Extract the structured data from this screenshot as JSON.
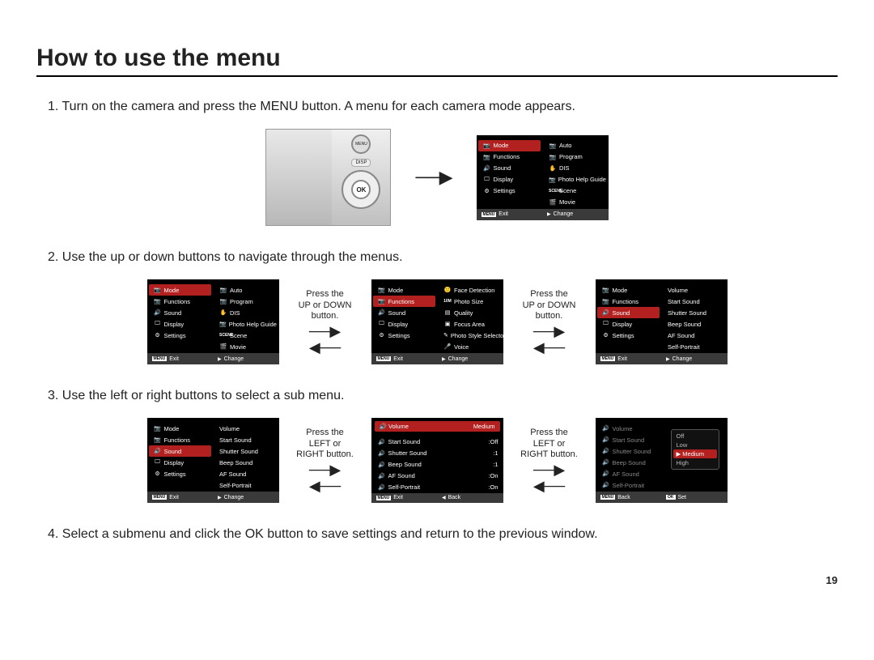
{
  "title": "How to use the menu",
  "page_number": "19",
  "steps": {
    "s1": "1. Turn on the camera and press the MENU button. A menu for each camera mode appears.",
    "s2": "2. Use the up or down buttons to navigate through the menus.",
    "s3": "3. Use the left or right buttons to select a sub menu.",
    "s4": "4. Select a submenu and click the OK button to save settings and return to the previous window."
  },
  "camera": {
    "menu": "MENU",
    "disp": "DISP",
    "ok": "OK"
  },
  "between": {
    "updown_l1": "Press the",
    "updown_l2": "UP or DOWN",
    "updown_l3": "button.",
    "leftright_l1": "Press the",
    "leftright_l2": "LEFT or",
    "leftright_l3": "RIGHT button."
  },
  "menuLeft": {
    "mode": "Mode",
    "functions": "Functions",
    "sound": "Sound",
    "display": "Display",
    "settings": "Settings"
  },
  "modeRight": {
    "auto": "Auto",
    "program": "Program",
    "dis": "DIS",
    "photo_help": "Photo Help Guide",
    "scene": "Scene",
    "movie": "Movie"
  },
  "functionsRight": {
    "face": "Face Detection",
    "photo_size": "Photo Size",
    "quality": "Quality",
    "focus": "Focus Area",
    "style": "Photo Style Selector",
    "voice": "Voice"
  },
  "soundRight": {
    "volume": "Volume",
    "start": "Start Sound",
    "shutter": "Shutter Sound",
    "beep": "Beep Sound",
    "af": "AF Sound",
    "self": "Self-Portrait"
  },
  "soundValues": {
    "volume": "Medium",
    "start": ":Off",
    "shutter": ":1",
    "beep": ":1",
    "af": ":On",
    "self": ":On"
  },
  "volumeOptions": {
    "off": "Off",
    "low": "Low",
    "medium": "Medium",
    "high": "High"
  },
  "footer": {
    "menu_tag": "MENU",
    "exit": "Exit",
    "change": "Change",
    "back": "Back",
    "set": "Set",
    "ok_tag": "OK"
  },
  "sceneTag": "SCENE"
}
